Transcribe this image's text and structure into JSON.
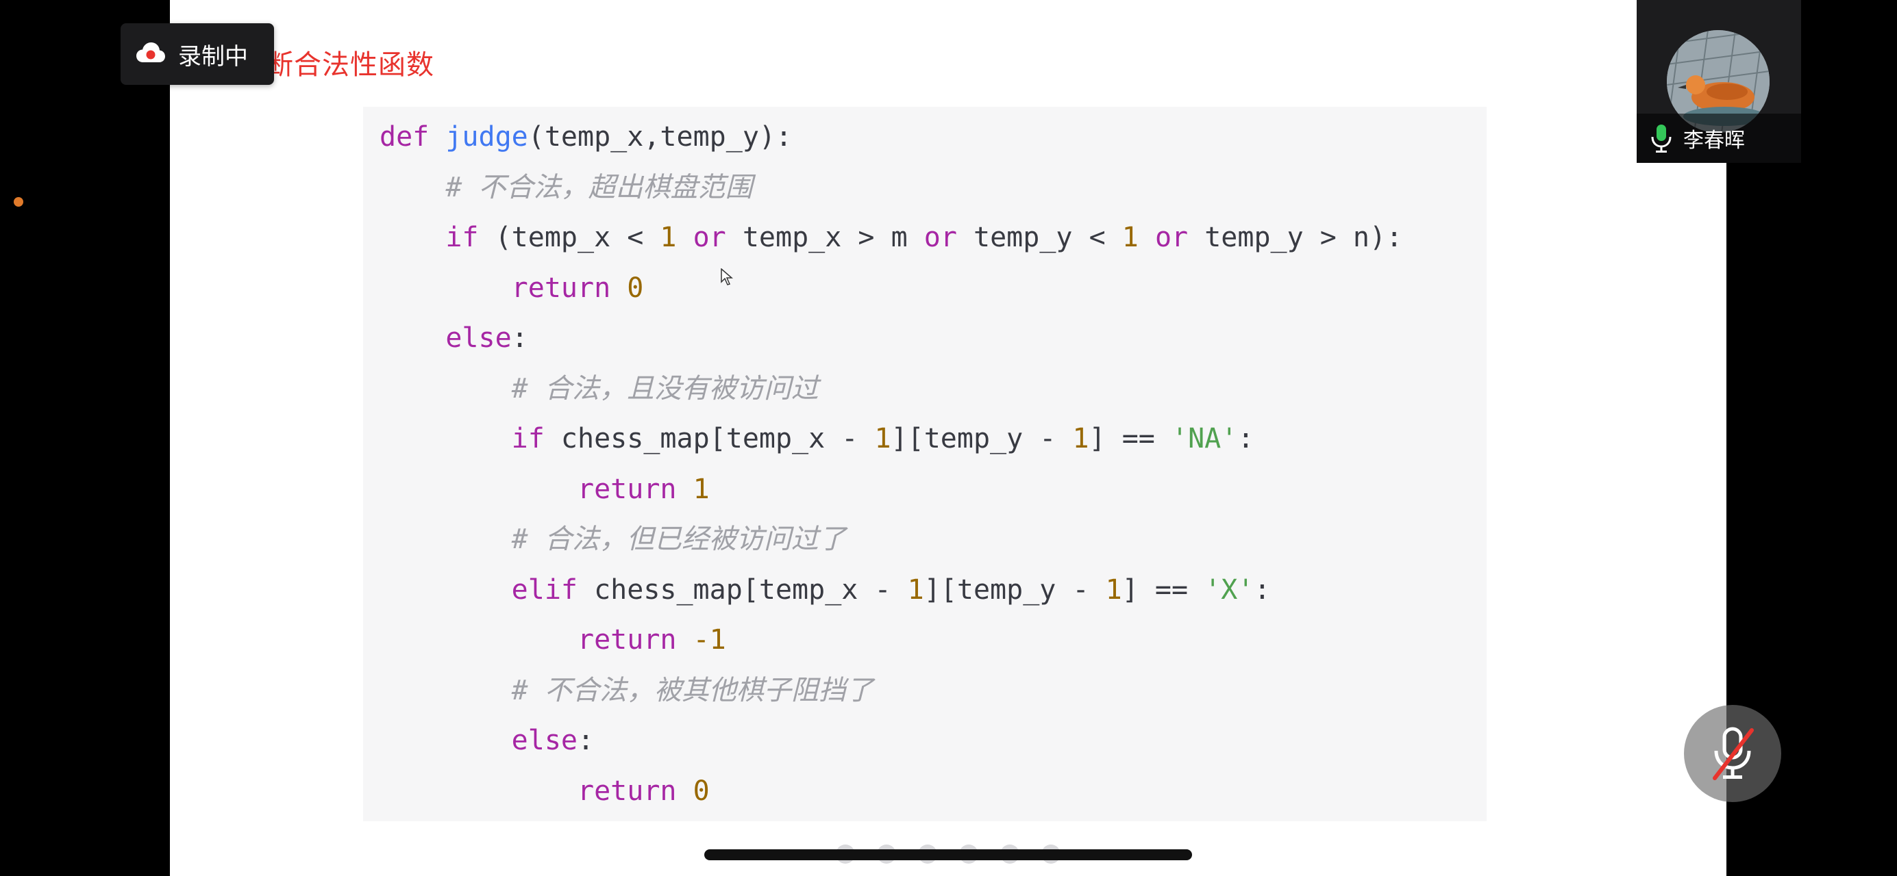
{
  "slide": {
    "title": "断合法性函数"
  },
  "code": {
    "lines": [
      [
        {
          "t": "def",
          "c": "kw"
        },
        {
          "t": " "
        },
        {
          "t": "judge",
          "c": "fn"
        },
        {
          "t": "(temp_x,temp_y):"
        }
      ],
      [
        {
          "t": "    "
        },
        {
          "t": "# 不合法，超出棋盘范围",
          "c": "cmt"
        }
      ],
      [
        {
          "t": "    "
        },
        {
          "t": "if",
          "c": "kw"
        },
        {
          "t": " (temp_x < "
        },
        {
          "t": "1",
          "c": "num"
        },
        {
          "t": " "
        },
        {
          "t": "or",
          "c": "kw"
        },
        {
          "t": " temp_x > m "
        },
        {
          "t": "or",
          "c": "kw"
        },
        {
          "t": " temp_y < "
        },
        {
          "t": "1",
          "c": "num"
        },
        {
          "t": " "
        },
        {
          "t": "or",
          "c": "kw"
        },
        {
          "t": " temp_y > n):"
        }
      ],
      [
        {
          "t": "        "
        },
        {
          "t": "return",
          "c": "kw"
        },
        {
          "t": " "
        },
        {
          "t": "0",
          "c": "num"
        }
      ],
      [
        {
          "t": "    "
        },
        {
          "t": "else",
          "c": "kw"
        },
        {
          "t": ":"
        }
      ],
      [
        {
          "t": "        "
        },
        {
          "t": "# 合法，且没有被访问过",
          "c": "cmt"
        }
      ],
      [
        {
          "t": "        "
        },
        {
          "t": "if",
          "c": "kw"
        },
        {
          "t": " chess_map[temp_x - "
        },
        {
          "t": "1",
          "c": "num"
        },
        {
          "t": "][temp_y - "
        },
        {
          "t": "1",
          "c": "num"
        },
        {
          "t": "] == "
        },
        {
          "t": "'NA'",
          "c": "str"
        },
        {
          "t": ":"
        }
      ],
      [
        {
          "t": "            "
        },
        {
          "t": "return",
          "c": "kw"
        },
        {
          "t": " "
        },
        {
          "t": "1",
          "c": "num"
        }
      ],
      [
        {
          "t": "        "
        },
        {
          "t": "# 合法，但已经被访问过了",
          "c": "cmt"
        }
      ],
      [
        {
          "t": "        "
        },
        {
          "t": "elif",
          "c": "kw"
        },
        {
          "t": " chess_map[temp_x - "
        },
        {
          "t": "1",
          "c": "num"
        },
        {
          "t": "][temp_y - "
        },
        {
          "t": "1",
          "c": "num"
        },
        {
          "t": "] == "
        },
        {
          "t": "'X'",
          "c": "str"
        },
        {
          "t": ":"
        }
      ],
      [
        {
          "t": "            "
        },
        {
          "t": "return",
          "c": "kw"
        },
        {
          "t": " "
        },
        {
          "t": "-1",
          "c": "num"
        }
      ],
      [
        {
          "t": "        "
        },
        {
          "t": "# 不合法，被其他棋子阻挡了",
          "c": "cmt"
        }
      ],
      [
        {
          "t": "        "
        },
        {
          "t": "else",
          "c": "kw"
        },
        {
          "t": ":"
        }
      ],
      [
        {
          "t": "            "
        },
        {
          "t": "return",
          "c": "kw"
        },
        {
          "t": " "
        },
        {
          "t": "0",
          "c": "num"
        }
      ]
    ]
  },
  "recording": {
    "label": "录制中",
    "icon": "cloud-record-icon"
  },
  "participant": {
    "name": "李春晖",
    "mic_icon": "mic-icon",
    "avatar_icon": "duck-avatar"
  },
  "controls": {
    "mute_icon": "mic-muted-icon"
  },
  "pager": {
    "dot_count": 6
  },
  "colors": {
    "title_red": "#e8332d",
    "keyword": "#a626a4",
    "function": "#4078f2",
    "number": "#986801",
    "string": "#50a14f",
    "comment": "#a0a1a7",
    "code_bg": "#f6f6f7"
  }
}
